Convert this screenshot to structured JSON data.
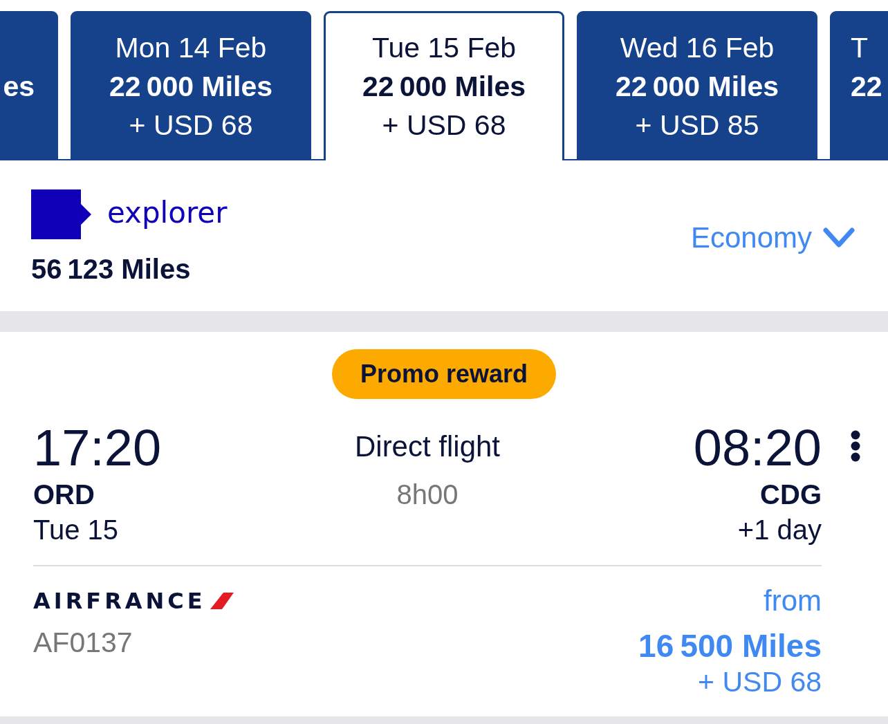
{
  "date_tabs": [
    {
      "kind": "cut_left",
      "miles": "es",
      "selected": false
    },
    {
      "kind": "full",
      "day": "Mon 14 Feb",
      "miles": "22 000 Miles",
      "price": "+ USD 68",
      "selected": false
    },
    {
      "kind": "full",
      "day": "Tue 15 Feb",
      "miles": "22 000 Miles",
      "price": "+ USD 68",
      "selected": true
    },
    {
      "kind": "full",
      "day": "Wed 16 Feb",
      "miles": "22 000 Miles",
      "price": "+ USD 85",
      "selected": false
    },
    {
      "kind": "cut_right",
      "day": "T",
      "miles": "22",
      "selected": false
    }
  ],
  "account": {
    "program": "explorer",
    "balance": "56 123 Miles"
  },
  "cabin_select": {
    "value": "Economy"
  },
  "flight": {
    "badge": "Promo reward",
    "departure": {
      "time": "17:20",
      "airport": "ORD",
      "date": "Tue 15"
    },
    "stops": "Direct flight",
    "duration": "8h00",
    "arrival": {
      "time": "08:20",
      "airport": "CDG",
      "date": "+1 day"
    },
    "airline": "AIRFRANCE",
    "flight_number": "AF0137",
    "price_prefix": "from",
    "price_miles": "16 500 Miles",
    "price_cash": "+ USD 68"
  }
}
